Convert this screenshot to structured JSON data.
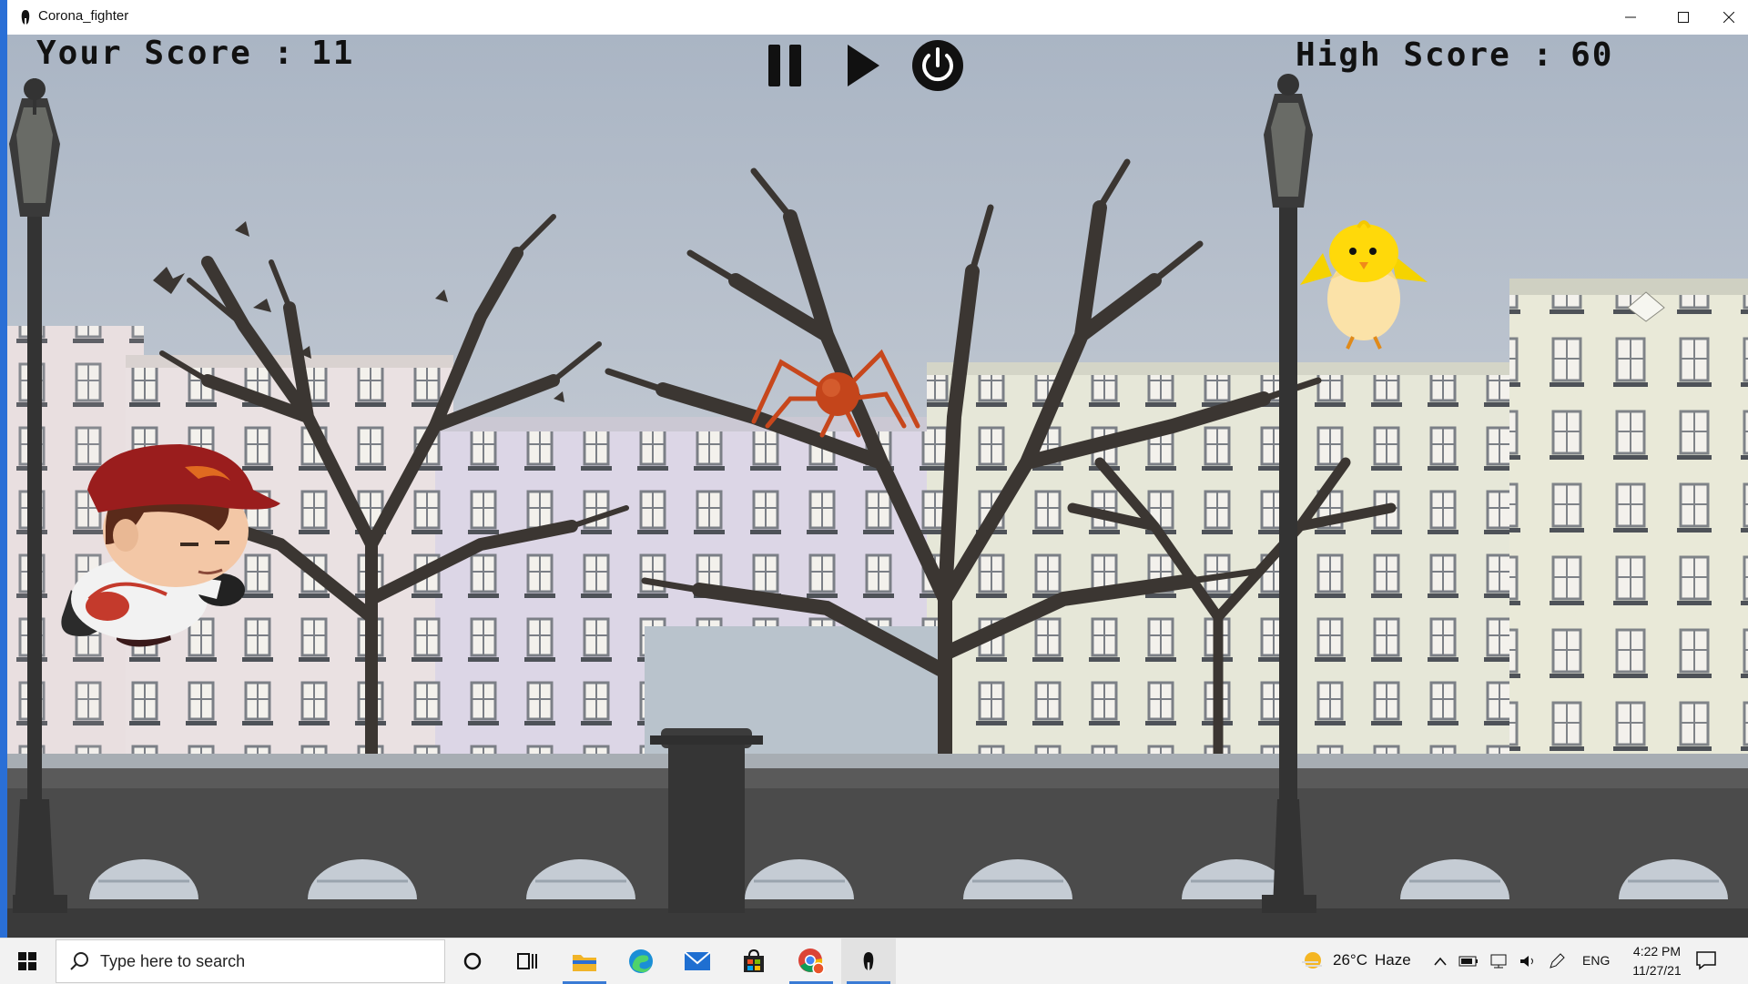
{
  "window": {
    "title": "Corona_fighter"
  },
  "hud": {
    "your_score_label": "Your Score :",
    "your_score": "11",
    "high_score_label": "High Score :",
    "high_score": "60"
  },
  "controls": {
    "pause_icon": "pause-icon",
    "play_icon": "play-icon",
    "power_icon": "power-icon"
  },
  "sprites": {
    "player": "boy-with-red-cap",
    "virus": "orange-spider-virus",
    "chick": "yellow-chick-in-egg"
  },
  "taskbar": {
    "search_placeholder": "Type here to search",
    "weather_temp": "26°C",
    "weather_desc": "Haze",
    "language": "ENG",
    "time": "4:22 PM",
    "date": "11/27/21"
  },
  "colors": {
    "sky_top": "#aeb8c7",
    "sky_bottom": "#d5d9de",
    "tree": "#3b3632",
    "bridge": "#4b4b4b",
    "accent": "#3a7bd5"
  }
}
